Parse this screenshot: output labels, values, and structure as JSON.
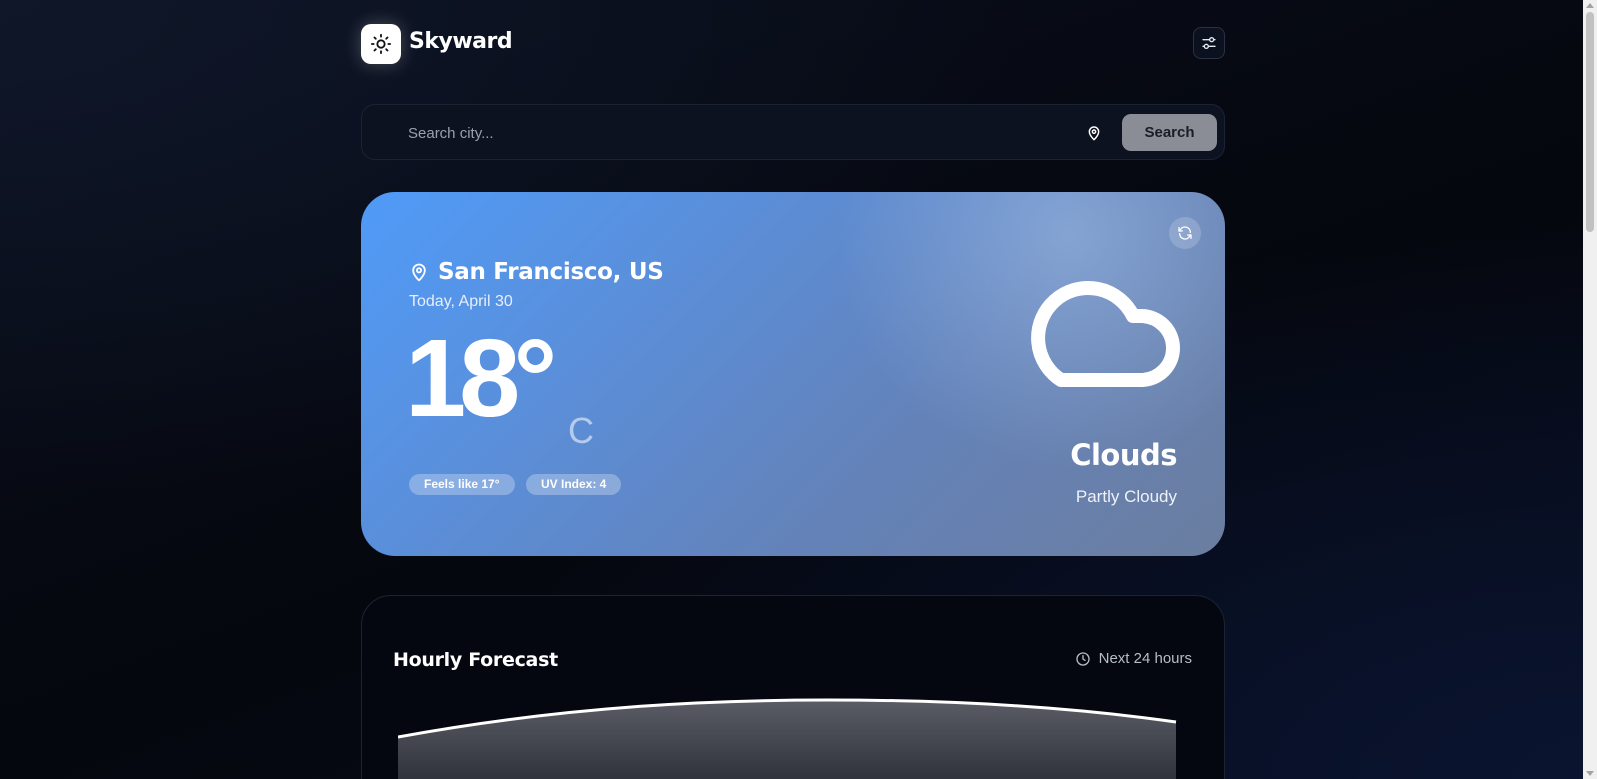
{
  "app": {
    "title": "Skyward",
    "logo_icon": "sun-icon",
    "settings_icon": "sliders-icon"
  },
  "search": {
    "placeholder": "Search city...",
    "value": "",
    "location_icon": "map-pin-icon",
    "button_label": "Search"
  },
  "current": {
    "location": "San Francisco, US",
    "date": "Today, April 30",
    "temperature": "18°",
    "unit": "C",
    "feels_like": "Feels like 17°",
    "uv_index": "UV Index: 4",
    "condition": "Clouds",
    "description": "Partly Cloudy",
    "condition_icon": "cloud-icon",
    "refresh_icon": "refresh-icon"
  },
  "hourly": {
    "title": "Hourly Forecast",
    "range_label": "Next 24 hours",
    "range_icon": "clock-icon"
  },
  "colors": {
    "background": "#060b16",
    "card_gradient_start": "#4f9bf8",
    "card_gradient_end": "#6b7ea0",
    "search_button": "#8a8d96"
  }
}
